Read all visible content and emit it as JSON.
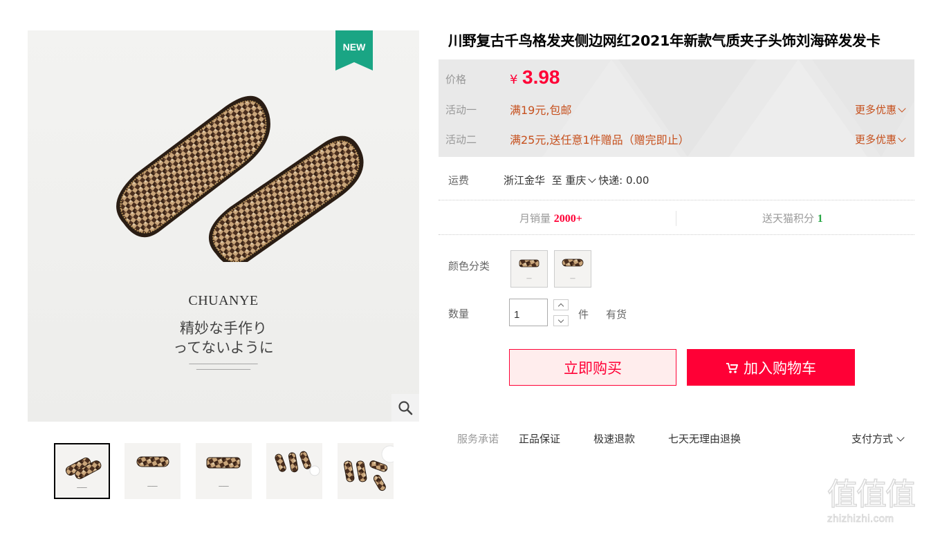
{
  "product": {
    "title": "川野复古千鸟格发夹侧边网红2021年新款气质夹子头饰刘海碎发发卡"
  },
  "gallery": {
    "badge": "NEW",
    "badge_color": "#1aa584",
    "image_text": {
      "brand": "CHUANYE",
      "line1": "精妙な手作り",
      "line2": "ってないように"
    },
    "thumbnail_count": 5,
    "selected_thumbnail": 1
  },
  "promo": {
    "price_label": "价格",
    "currency": "¥",
    "price": "3.98",
    "activity1_label": "活动一",
    "activity1_text": "满19元,包邮",
    "activity2_label": "活动二",
    "activity2_text": "满25元,送任意1件赠品（赠完即止）",
    "more_label": "更多优惠"
  },
  "shipping": {
    "label": "运费",
    "from": "浙江金华",
    "to_word": "至",
    "to_city": "重庆",
    "method": "快递: 0.00"
  },
  "stats": {
    "sales_label": "月销量",
    "sales_value": "2000+",
    "points_label": "送天猫积分",
    "points_value": "1"
  },
  "sku": {
    "color_label": "颜色分类",
    "option_count": 2
  },
  "quantity": {
    "label": "数量",
    "value": "1",
    "unit": "件",
    "stock": "有货"
  },
  "actions": {
    "buy_now": "立即购买",
    "add_to_cart": "加入购物车",
    "accent": "#ff0036"
  },
  "service": {
    "label": "服务承诺",
    "items": [
      "正品保证",
      "极速退款",
      "七天无理由退换"
    ],
    "payment": "支付方式"
  },
  "watermark": {
    "glyphs": "值值值",
    "url": "zhizhizhi.com"
  }
}
